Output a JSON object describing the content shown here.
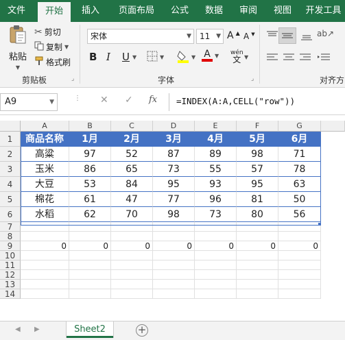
{
  "ribbon_tabs": [
    "文件",
    "开始",
    "插入",
    "页面布局",
    "公式",
    "数据",
    "审阅",
    "视图",
    "开发工具"
  ],
  "active_tab": "开始",
  "accent_color": "#217346",
  "clipboard": {
    "paste_label": "粘贴",
    "cut_label": "剪切",
    "copy_label": "复制",
    "format_painter_label": "格式刷",
    "group_label": "剪贴板"
  },
  "font": {
    "font_name": "宋体",
    "font_size": "11",
    "bold_label": "B",
    "italic_label": "I",
    "underline_label": "U",
    "grow_label": "A",
    "shrink_label": "A",
    "wen_label": "wén",
    "wen_char": "文",
    "group_label": "字体"
  },
  "alignment": {
    "group_label": "对齐方"
  },
  "formula_bar": {
    "name_box": "A9",
    "cancel_icon": "✕",
    "enter_icon": "✓",
    "fx_label": "fx",
    "formula": "=INDEX(A:A,CELL(\"row\"))"
  },
  "columns": [
    "A",
    "B",
    "C",
    "D",
    "E",
    "F",
    "G"
  ],
  "rows": [
    "1",
    "2",
    "3",
    "4",
    "5",
    "6",
    "7",
    "8",
    "9",
    "10",
    "11",
    "12",
    "13",
    "14"
  ],
  "table": {
    "header": [
      "商品名称",
      "1月",
      "2月",
      "3月",
      "4月",
      "5月",
      "6月"
    ],
    "body": [
      [
        "高粱",
        "97",
        "52",
        "87",
        "89",
        "98",
        "71"
      ],
      [
        "玉米",
        "86",
        "65",
        "73",
        "55",
        "57",
        "78"
      ],
      [
        "大豆",
        "53",
        "84",
        "95",
        "93",
        "95",
        "63"
      ],
      [
        "棉花",
        "61",
        "47",
        "77",
        "96",
        "81",
        "50"
      ],
      [
        "水稻",
        "62",
        "70",
        "98",
        "73",
        "80",
        "56"
      ]
    ],
    "header_color": "#4472c4"
  },
  "row9_values": [
    "0",
    "0",
    "0",
    "0",
    "0",
    "0",
    "0"
  ],
  "sheet_tabs": [
    "Sheet2"
  ],
  "add_sheet_icon": "+"
}
